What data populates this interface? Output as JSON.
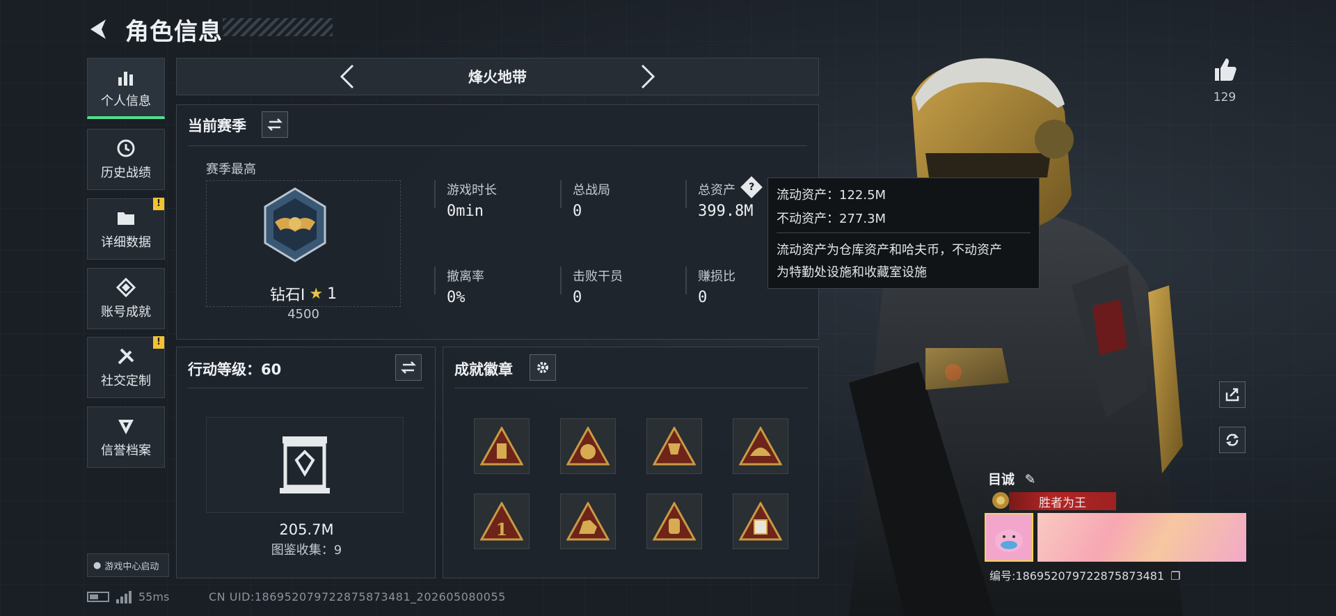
{
  "header": {
    "title": "角色信息"
  },
  "nav": {
    "items": [
      {
        "label": "个人信息",
        "icon": "bar-chart-icon",
        "active": true,
        "badge": ""
      },
      {
        "label": "历史战绩",
        "icon": "clock-icon",
        "active": false,
        "badge": ""
      },
      {
        "label": "详细数据",
        "icon": "folder-icon",
        "active": false,
        "badge": "!"
      },
      {
        "label": "账号成就",
        "icon": "diamond-icon",
        "active": false,
        "badge": ""
      },
      {
        "label": "社交定制",
        "icon": "tools-icon",
        "active": false,
        "badge": "!"
      },
      {
        "label": "信誉档案",
        "icon": "shield-icon",
        "active": false,
        "badge": ""
      }
    ],
    "launch_label": "游戏中心启动"
  },
  "status": {
    "ping": "55ms",
    "uid": "CN UID:18695207972287587348​1_202605080055"
  },
  "mode": {
    "title": "烽火地带"
  },
  "season": {
    "title": "当前赛季",
    "best_label": "赛季最高",
    "rank_name": "钻石Ⅰ",
    "rank_stars": "1",
    "rank_points": "4500",
    "stats": [
      {
        "label": "游戏时长",
        "value": "0min"
      },
      {
        "label": "总战局",
        "value": "0"
      },
      {
        "label": "总资产",
        "value": "399.8M"
      },
      {
        "label": "撤离率",
        "value": "0%"
      },
      {
        "label": "击败干员",
        "value": "0"
      },
      {
        "label": "赚损比",
        "value": "0"
      }
    ]
  },
  "tooltip": {
    "line1": "流动资产：122.5M",
    "line2": "不动资产：277.3M",
    "desc1": "流动资产为仓库资产和哈夫币，不动资产",
    "desc2": "为特勤处设施和收藏室设施"
  },
  "level": {
    "title": "行动等级：60",
    "value": "205.7M",
    "collection": "图鉴收集：9"
  },
  "badges": {
    "title": "成就徽章",
    "items": [
      "bottle-badge-icon",
      "cross-badge-icon",
      "trophy-badge-icon",
      "hat-badge-icon",
      "number-one-badge-icon",
      "beast-badge-icon",
      "backpack-badge-icon",
      "sign-badge-icon"
    ]
  },
  "profile": {
    "likes": "129",
    "name": "目诚",
    "title_banner": "胜者为王",
    "id_text": "编号:1869520797228758734​81"
  },
  "colors": {
    "accent": "#4ee08e",
    "warning": "#f2c232",
    "banner_red": "#b32525"
  }
}
